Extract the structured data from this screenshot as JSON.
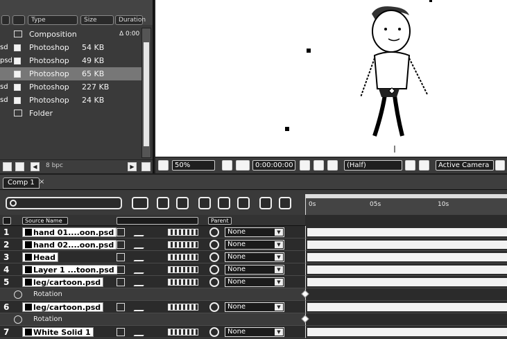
{
  "project": {
    "columns": {
      "type": "Type",
      "size": "Size",
      "duration": "Duration"
    },
    "items": [
      {
        "prefix": "",
        "type": "Composition",
        "size": "",
        "duration": "Δ 0:00"
      },
      {
        "prefix": "sd",
        "type": "Photoshop",
        "size": "54 KB",
        "duration": ""
      },
      {
        "prefix": "psd",
        "type": "Photoshop",
        "size": "49 KB",
        "duration": ""
      },
      {
        "prefix": "",
        "type": "Photoshop",
        "size": "65 KB",
        "duration": ""
      },
      {
        "prefix": "sd",
        "type": "Photoshop",
        "size": "227 KB",
        "duration": ""
      },
      {
        "prefix": "sd",
        "type": "Photoshop",
        "size": "24 KB",
        "duration": ""
      },
      {
        "prefix": "",
        "type": "Folder",
        "size": "",
        "duration": ""
      }
    ],
    "footer": {
      "bpc": "8 bpc"
    }
  },
  "viewer": {
    "zoom": "50%",
    "timecode": "0:00:00:00",
    "resolution": "(Half)",
    "camera": "Active Camera"
  },
  "timeline": {
    "tab_label": "Comp 1",
    "tab_close": "×",
    "search_placeholder": "",
    "ruler": [
      "0s",
      "05s",
      "10s"
    ],
    "col_source": "Source Name",
    "col_parent": "Parent",
    "layers": [
      {
        "num": "1",
        "name": "hand 01....oon.psd",
        "parent": "None"
      },
      {
        "num": "2",
        "name": "hand 02....oon.psd",
        "parent": "None"
      },
      {
        "num": "3",
        "name": "Head",
        "parent": "None"
      },
      {
        "num": "4",
        "name": "Layer 1 ...toon.psd",
        "parent": "None"
      },
      {
        "num": "5",
        "name": "leg/cartoon.psd",
        "parent": "None"
      }
    ],
    "property_rotation": "Rotation",
    "layer6": {
      "num": "6",
      "name": "leg/cartoon.psd",
      "parent": "None"
    },
    "property_rotation2": "Rotation",
    "layer7": {
      "num": "7",
      "name": "White Solid 1",
      "parent": "None"
    }
  },
  "colors": {
    "panel": "#3a3a3a",
    "viewer_bg": "#ffffff",
    "track_bar": "#f2f2f2"
  }
}
